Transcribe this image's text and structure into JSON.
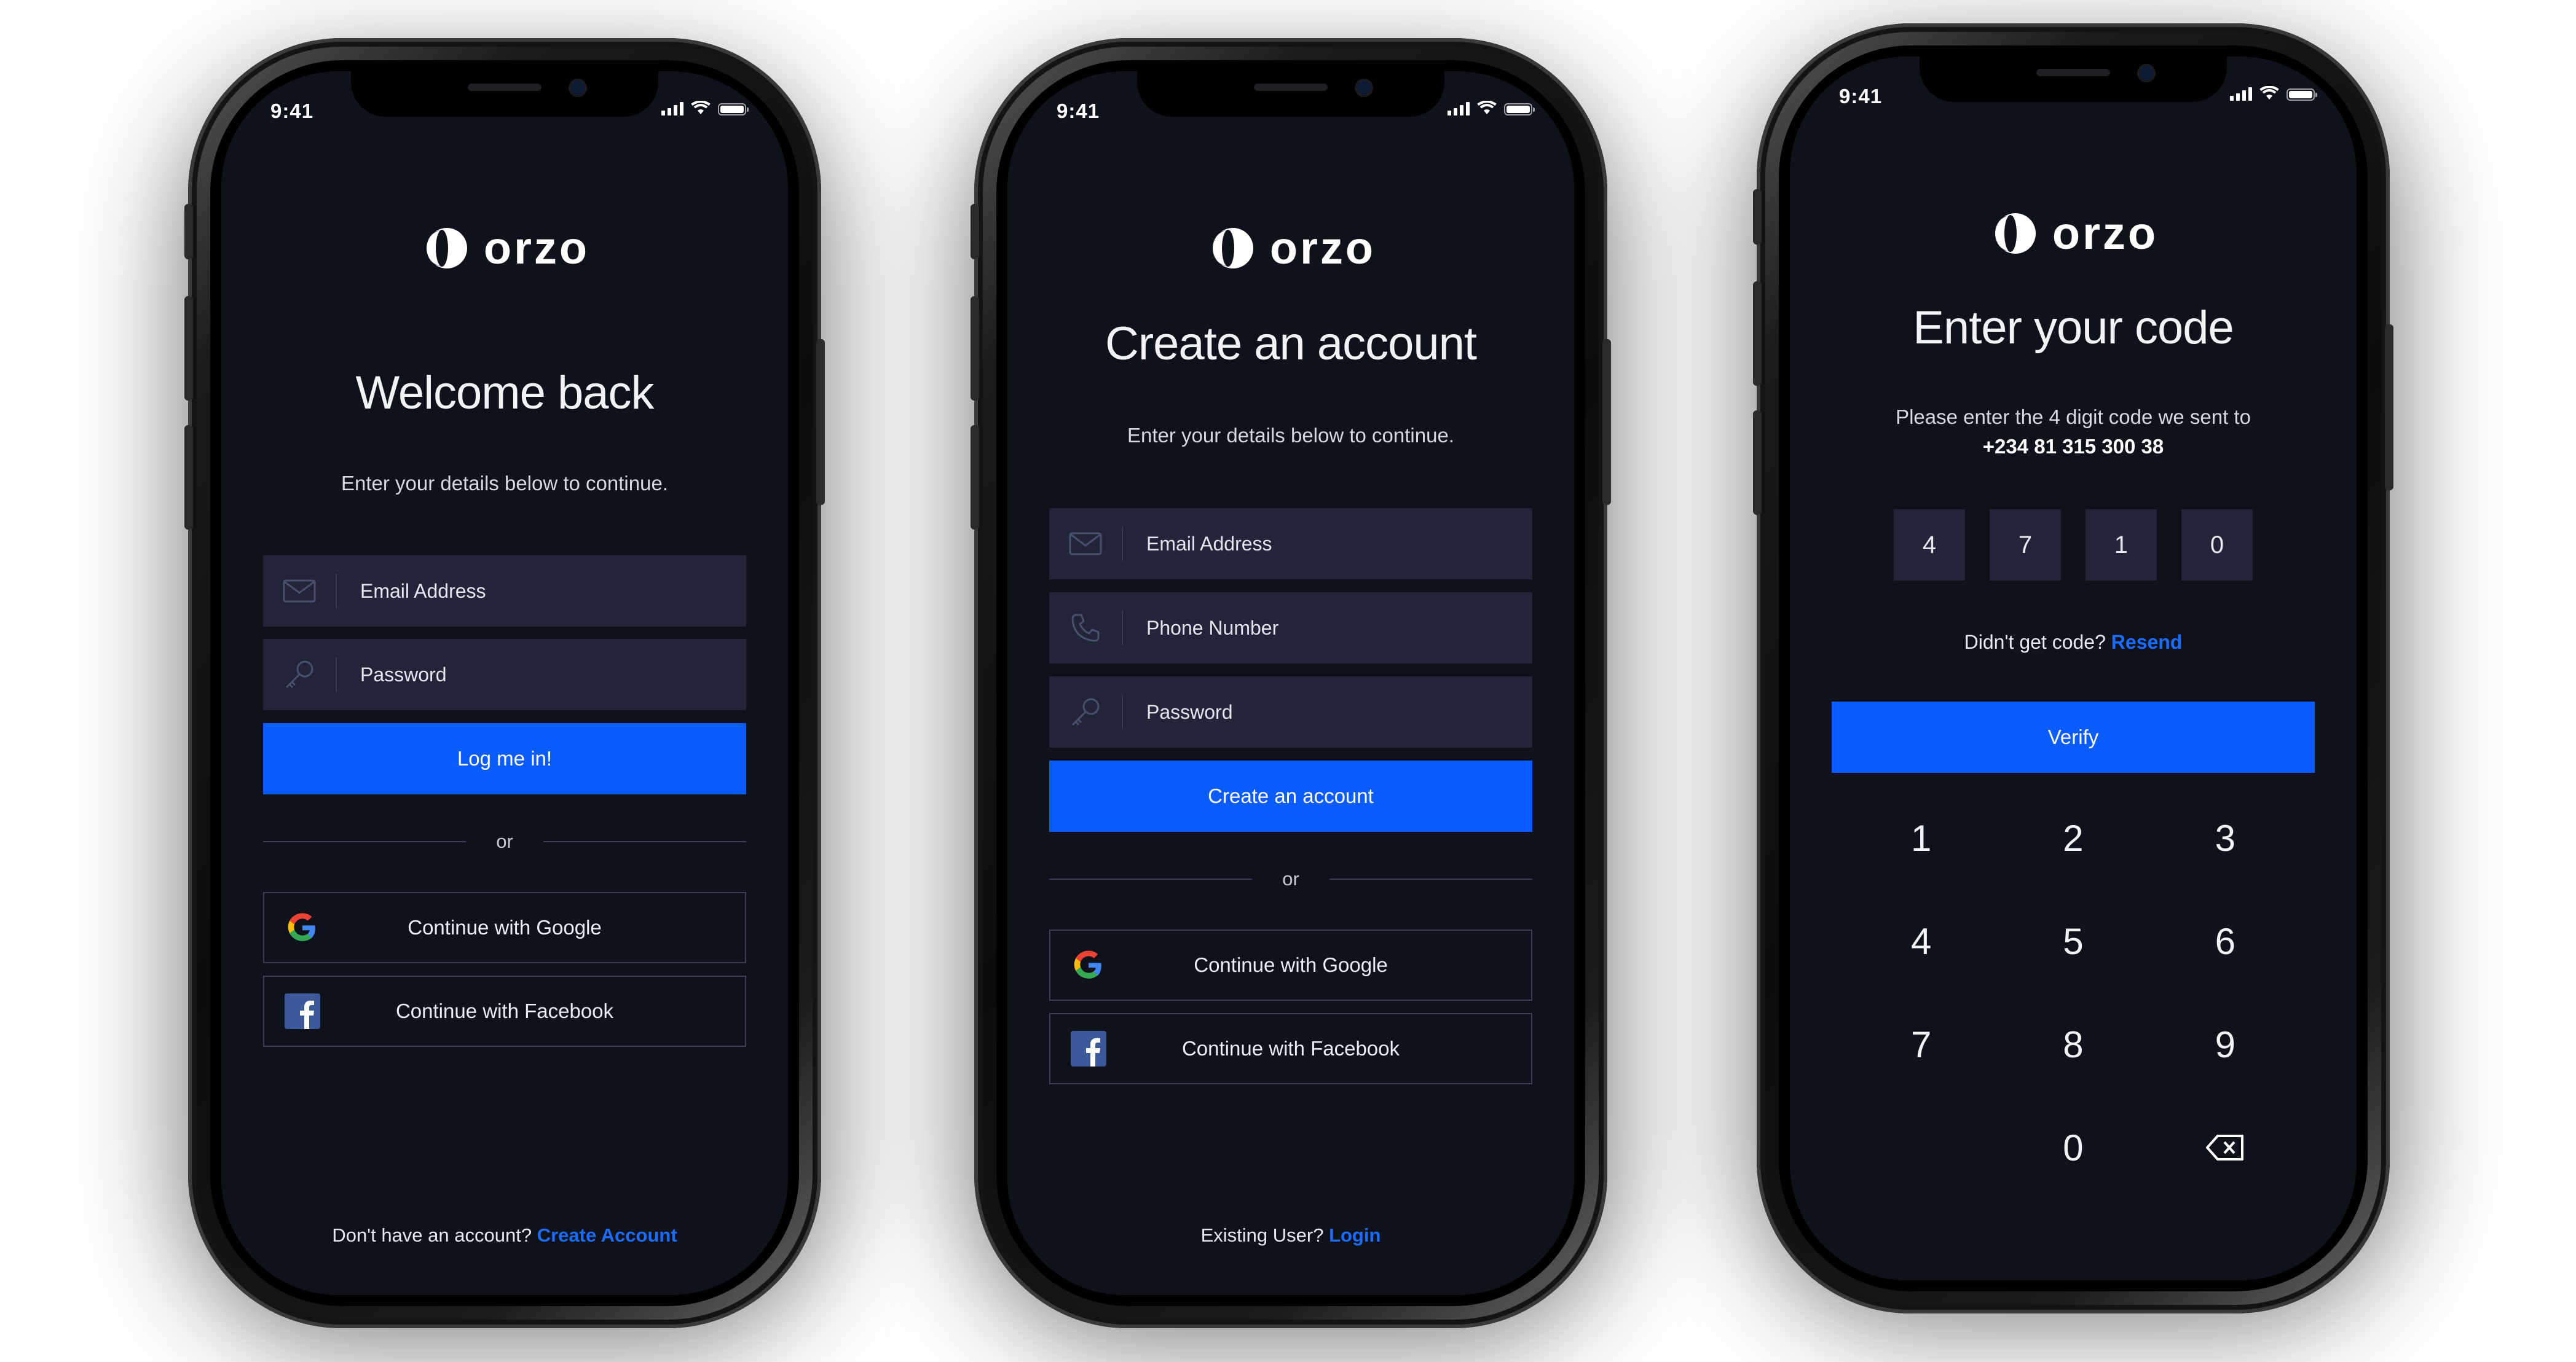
{
  "brand": {
    "name": "orzo",
    "accent": "#0a5cff",
    "link": "#1a6dff",
    "background": "#10121b",
    "field": "#22253a"
  },
  "status_bar": {
    "time": "9:41",
    "icons": [
      "signal-icon",
      "wifi-icon",
      "battery-icon"
    ]
  },
  "login_screen": {
    "heading": "Welcome back",
    "subtitle": "Enter your details below to continue.",
    "email_placeholder": "Email Address",
    "password_placeholder": "Password",
    "submit_label": "Log me in!",
    "divider_label": "or",
    "google_label": "Continue with Google",
    "facebook_label": "Continue with Facebook",
    "footer_text": "Don't have an account?",
    "footer_link": "Create Account"
  },
  "signup_screen": {
    "heading": "Create an account",
    "subtitle": "Enter your details below to continue.",
    "email_placeholder": "Email Address",
    "phone_placeholder": "Phone Number",
    "password_placeholder": "Password",
    "submit_label": "Create an account",
    "divider_label": "or",
    "google_label": "Continue with Google",
    "facebook_label": "Continue with Facebook",
    "footer_text": "Existing User?",
    "footer_link": "Login"
  },
  "verify_screen": {
    "heading": "Enter your code",
    "instruction": "Please enter the 4 digit code we sent to",
    "phone": "+234 81 315 300 38",
    "code": [
      "4",
      "7",
      "1",
      "0"
    ],
    "resend_text": "Didn't get code?",
    "resend_link": "Resend",
    "submit_label": "Verify",
    "keypad": [
      "1",
      "2",
      "3",
      "4",
      "5",
      "6",
      "7",
      "8",
      "9",
      "",
      "0",
      "backspace-icon"
    ]
  }
}
